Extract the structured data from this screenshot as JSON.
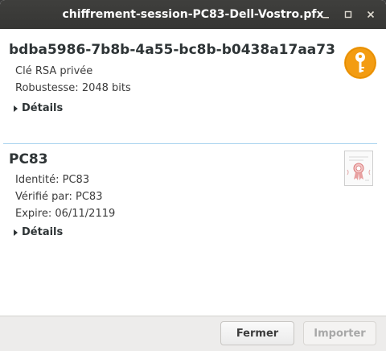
{
  "window": {
    "title": "chiffrement-session-PC83-Dell-Vostro.pfx"
  },
  "key_section": {
    "heading": "bdba5986-7b8b-4a55-bc8b-b0438a17aa73",
    "type": "Clé RSA privée",
    "strength": "Robustesse: 2048 bits",
    "details_label": "Détails",
    "icon": "key-icon",
    "icon_color": "#f39c12"
  },
  "cert_section": {
    "heading": "PC83",
    "identity": "Identité: PC83",
    "verified_by": "Vérifié par: PC83",
    "expires": "Expire: 06/11/2119",
    "details_label": "Détails",
    "icon": "certificate-icon"
  },
  "footer": {
    "close_label": "Fermer",
    "import_label": "Importer"
  }
}
